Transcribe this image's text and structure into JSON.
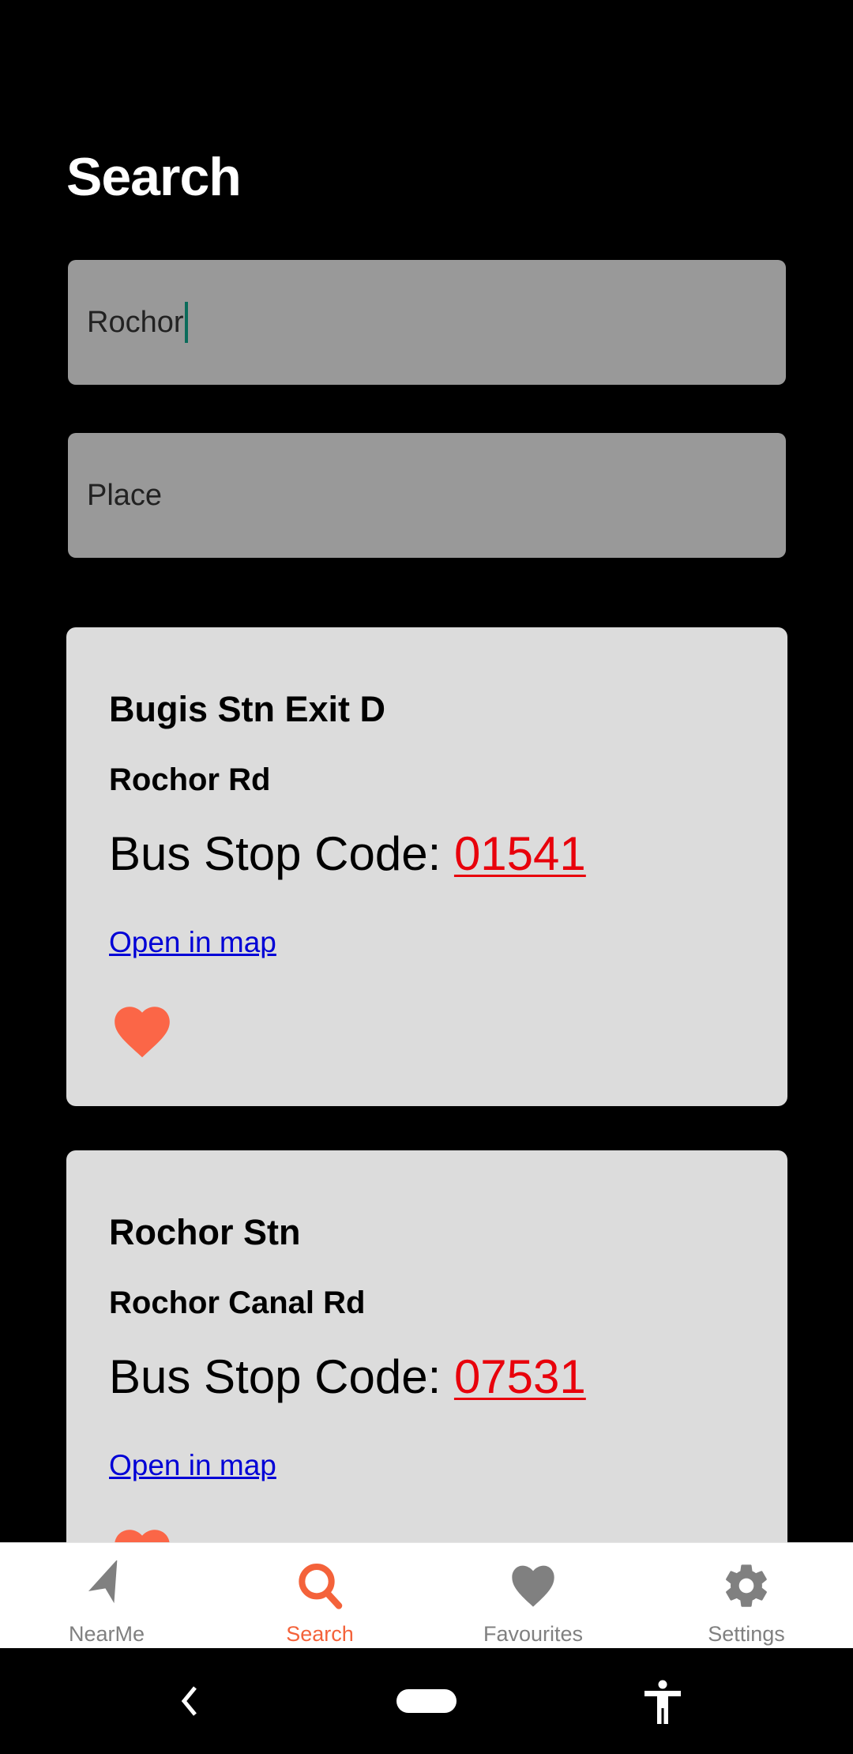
{
  "page": {
    "title": "Search"
  },
  "search": {
    "query_value": "Rochor",
    "place_placeholder": "Place"
  },
  "results": [
    {
      "name": "Bugis Stn Exit D",
      "road": "Rochor Rd",
      "code_label": "Bus Stop Code: ",
      "code": "01541",
      "link": "Open in map",
      "favourite": true
    },
    {
      "name": "Rochor Stn",
      "road": "Rochor Canal Rd",
      "code_label": "Bus Stop Code: ",
      "code": "07531",
      "link": "Open in map",
      "favourite": true
    }
  ],
  "tabs": [
    {
      "label": "NearMe",
      "icon": "navigation-arrow-icon",
      "active": false
    },
    {
      "label": "Search",
      "icon": "search-icon",
      "active": true
    },
    {
      "label": "Favourites",
      "icon": "heart-icon",
      "active": false
    },
    {
      "label": "Settings",
      "icon": "gear-icon",
      "active": false
    }
  ],
  "colors": {
    "accent": "#f4623a",
    "heart": "#fb6647",
    "code": "#e8000b",
    "link": "#0000d6",
    "inactive": "#808080"
  }
}
